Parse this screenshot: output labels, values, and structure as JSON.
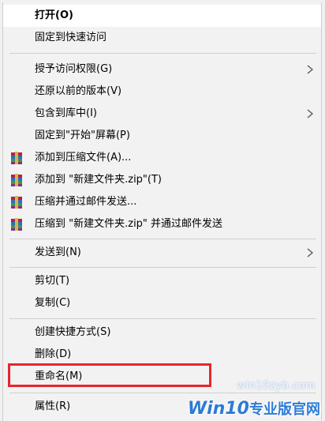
{
  "menu": {
    "items": [
      {
        "label": "打开(O)"
      },
      {
        "label": "固定到快速访问"
      },
      {
        "label": "授予访问权限(G)"
      },
      {
        "label": "还原以前的版本(V)"
      },
      {
        "label": "包含到库中(I)"
      },
      {
        "label": "固定到\"开始\"屏幕(P)"
      },
      {
        "label": "添加到压缩文件(A)..."
      },
      {
        "label": "添加到 \"新建文件夹.zip\"(T)"
      },
      {
        "label": "压缩并通过邮件发送..."
      },
      {
        "label": "压缩到 \"新建文件夹.zip\" 并通过邮件发送"
      },
      {
        "label": "发送到(N)"
      },
      {
        "label": "剪切(T)"
      },
      {
        "label": "复制(C)"
      },
      {
        "label": "创建快捷方式(S)"
      },
      {
        "label": "删除(D)"
      },
      {
        "label": "重命名(M)"
      },
      {
        "label": "属性(R)"
      }
    ],
    "submenu_arrow_icon": "chevron-right-icon",
    "archive_icon": "winrar-icon",
    "highlight_color": "#e8252b"
  },
  "watermark": {
    "url": "win10zyb.com",
    "brand_latin": "Win10",
    "brand_cn": "专业版官网"
  }
}
